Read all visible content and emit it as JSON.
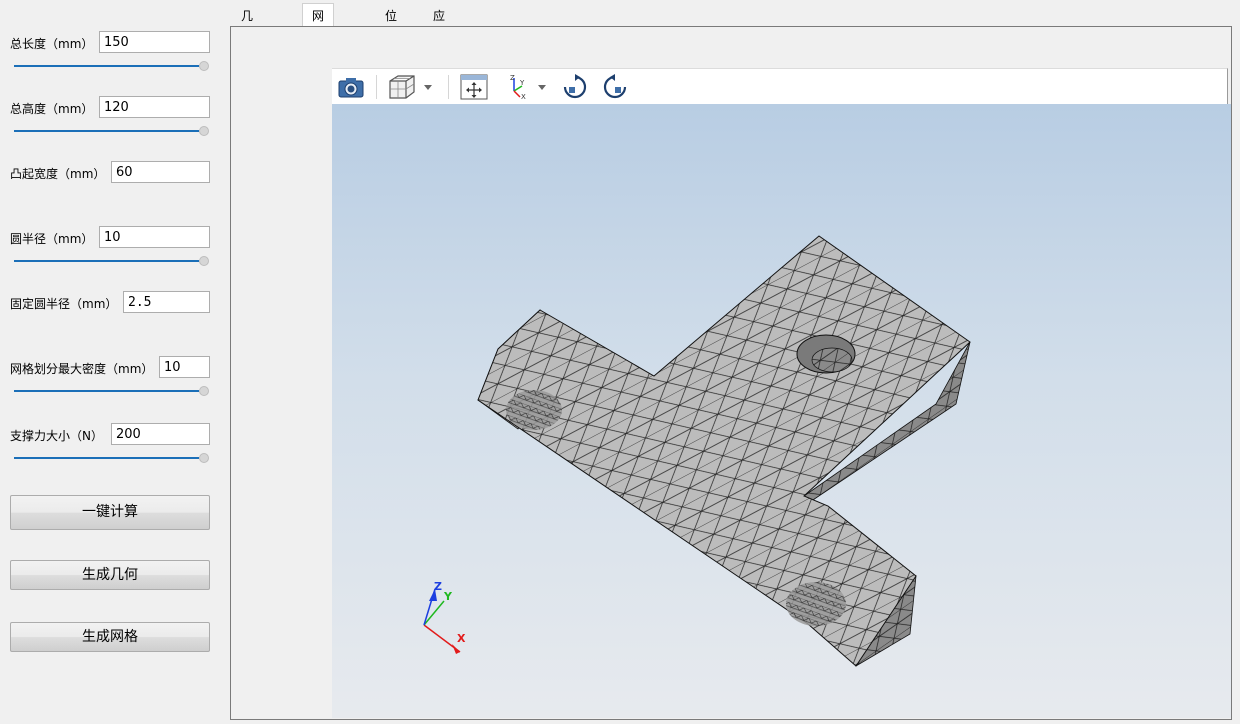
{
  "tabs": [
    {
      "label": "几何结构"
    },
    {
      "label": "网格划分"
    },
    {
      "label": "位移"
    },
    {
      "label": "应力"
    }
  ],
  "active_tab": "网格划分",
  "params": {
    "total_length": {
      "label": "总长度（mm）",
      "value": "150",
      "slider_fraction": 1.0
    },
    "total_height": {
      "label": "总高度（mm）",
      "value": "120",
      "slider_fraction": 1.0
    },
    "boss_width": {
      "label": "凸起宽度（mm）",
      "value": "60"
    },
    "circle_radius": {
      "label": "圆半径（mm）",
      "value": "10",
      "slider_fraction": 1.0
    },
    "fixed_circle_radius": {
      "label": "固定圆半径（mm）",
      "value": "2.5"
    },
    "mesh_max_density": {
      "label": "网格划分最大密度（mm）",
      "value": "10",
      "slider_fraction": 1.0
    },
    "support_force": {
      "label": "支撑力大小（N）",
      "value": "200",
      "slider_fraction": 1.0
    }
  },
  "buttons": {
    "compute": "一键计算",
    "gen_geometry": "生成几何",
    "gen_mesh": "生成网格"
  },
  "toolbar_icons": [
    "camera-icon",
    "view-cube-icon",
    "fit-all-icon",
    "axes-orientation-icon",
    "rotate-cw-icon",
    "rotate-ccw-icon"
  ],
  "axis_triad": {
    "x": "X",
    "y": "Y",
    "z": "Z",
    "x_color": "#e21b1b",
    "y_color": "#1fb81f",
    "z_color": "#1c3fe0"
  },
  "colors": {
    "accent": "#1b6fb8",
    "mesh_face": "#b9b9b9",
    "mesh_edge": "#1a1a1a"
  }
}
